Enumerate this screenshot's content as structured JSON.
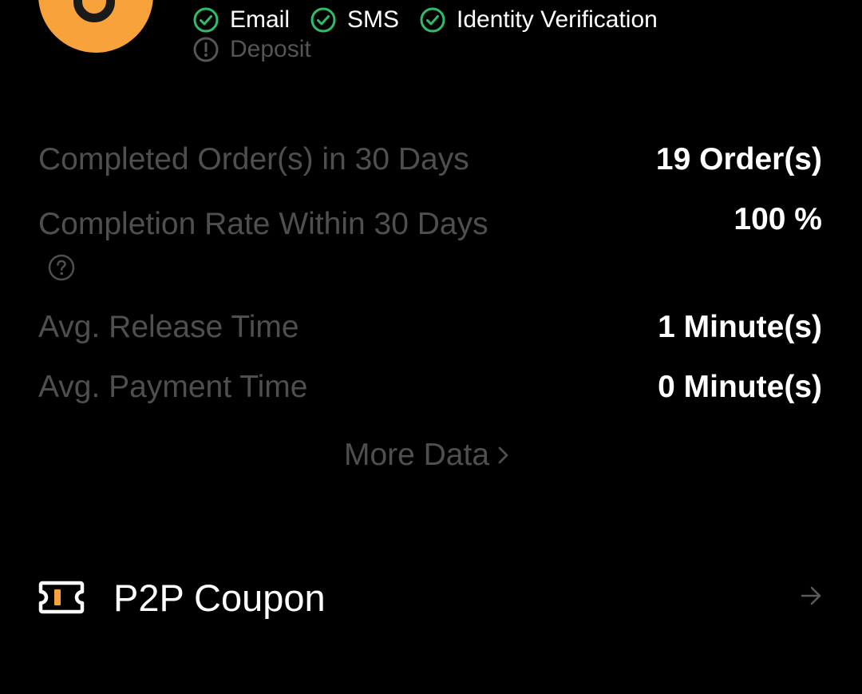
{
  "merchant": {
    "avatar_color": "#f7a23b"
  },
  "verifications": [
    {
      "label": "Email",
      "status": "verified",
      "icon": "check-circle-icon"
    },
    {
      "label": "SMS",
      "status": "verified",
      "icon": "check-circle-icon"
    },
    {
      "label": "Identity Verification",
      "status": "verified",
      "icon": "check-circle-icon"
    },
    {
      "label": "Deposit",
      "status": "pending",
      "icon": "exclamation-circle-icon"
    }
  ],
  "stats": {
    "completed_orders": {
      "label": "Completed Order(s) in 30 Days",
      "value": "19 Order(s)"
    },
    "completion_rate": {
      "label": "Completion Rate Within 30 Days",
      "value": "100 %",
      "help_icon": "question-circle-icon"
    },
    "avg_release_time": {
      "label": "Avg. Release Time",
      "value": "1 Minute(s)"
    },
    "avg_payment_time": {
      "label": "Avg. Payment Time",
      "value": "0 Minute(s)"
    }
  },
  "more_data": {
    "label": "More Data",
    "icon": "chevron-right-icon"
  },
  "coupon": {
    "label": "P2P Coupon",
    "icon": "ticket-icon",
    "arrow_icon": "arrow-right-icon"
  },
  "colors": {
    "background": "#000000",
    "verified_green": "#2ebd6b",
    "muted_text": "#4f4f4f",
    "accent_orange": "#f7a23b"
  }
}
